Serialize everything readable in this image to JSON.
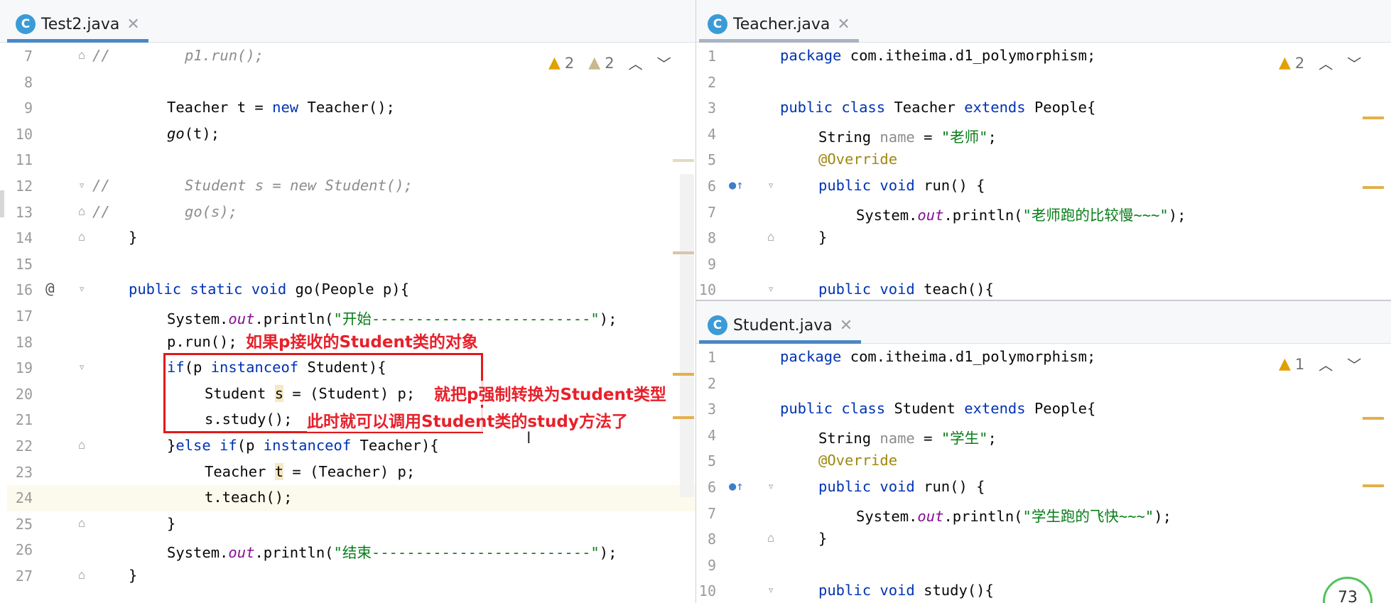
{
  "left_tab": {
    "title": "Test2.java",
    "icon": "C"
  },
  "teacher_tab": {
    "title": "Teacher.java",
    "icon": "C"
  },
  "student_tab": {
    "title": "Student.java",
    "icon": "C"
  },
  "left_inspection": {
    "warn1": "2",
    "warn2": "2"
  },
  "teacher_inspection": {
    "warn": "2"
  },
  "student_inspection": {
    "warn": "1"
  },
  "left_lines": [
    "7",
    "8",
    "9",
    "10",
    "11",
    "12",
    "13",
    "14",
    "15",
    "16",
    "17",
    "18",
    "19",
    "20",
    "21",
    "22",
    "23",
    "24",
    "25",
    "26",
    "27"
  ],
  "right_lines": [
    "1",
    "2",
    "3",
    "4",
    "5",
    "6",
    "7",
    "8",
    "9",
    "10"
  ],
  "code_left": {
    "l7_c": "//",
    "l7": "p1.run();",
    "l9_a": "Teacher t = ",
    "l9_kw": "new",
    "l9_b": " Teacher();",
    "l10_fn": "go",
    "l10": "(t);",
    "l12_c": "//",
    "l12": "Student s = new Student();",
    "l13_c": "//",
    "l13": "go(s);",
    "l14": "}",
    "l16_gutter": "@",
    "l16_kw": "public static void ",
    "l16": "go(People p){",
    "l17_a": "System.",
    "l17_f": "out",
    "l17_b": ".println(",
    "l17_s": "\"开始-------------------------\"",
    "l17_c": ");",
    "l18": "p.run();",
    "l19_kw": "if",
    "l19_a": "(p ",
    "l19_kw2": "instanceof",
    "l19_b": " Student){",
    "l20_a": "Student ",
    "l20_v": "s",
    "l20_b": " = (Student) p;",
    "l21": "s.study();",
    "l22_a": "}",
    "l22_kw": "else if",
    "l22_b": "(p ",
    "l22_kw2": "instanceof",
    "l22_c": " Teacher){",
    "l23_a": "Teacher ",
    "l23_v": "t",
    "l23_b": " = (Teacher) p;",
    "l24": "t.teach();",
    "l25": "}",
    "l26_a": "System.",
    "l26_f": "out",
    "l26_b": ".println(",
    "l26_s": "\"结束-------------------------\"",
    "l26_c": ");",
    "l27": "}"
  },
  "code_teacher": {
    "l1_kw": "package",
    "l1": " com.itheima.d1_polymorphism;",
    "l3_kw": "public class",
    "l3_a": " Teacher ",
    "l3_kw2": "extends",
    "l3_b": " People{",
    "l4_a": "String ",
    "l4_v": "name",
    "l4_b": " = ",
    "l4_s": "\"老师\"",
    "l4_c": ";",
    "l5": "@Override",
    "l6_kw": "public void",
    "l6": " run() {",
    "l7_a": "System.",
    "l7_f": "out",
    "l7_b": ".println(",
    "l7_s": "\"老师跑的比较慢~~~\"",
    "l7_c": ");",
    "l8": "}",
    "l10_kw": "public void",
    "l10": " teach(){"
  },
  "code_student": {
    "l1_kw": "package",
    "l1": " com.itheima.d1_polymorphism;",
    "l3_kw": "public class",
    "l3_a": " Student ",
    "l3_kw2": "extends",
    "l3_b": " People{",
    "l4_a": "String ",
    "l4_v": "name",
    "l4_b": " = ",
    "l4_s": "\"学生\"",
    "l4_c": ";",
    "l5": "@Override",
    "l6_kw": "public void",
    "l6": " run() {",
    "l7_a": "System.",
    "l7_f": "out",
    "l7_b": ".println(",
    "l7_s": "\"学生跑的飞快~~~\"",
    "l7_c": ");",
    "l8": "}",
    "l10_kw": "public void",
    "l10": " study(){"
  },
  "annotations": {
    "a1": "如果p接收的Student类的对象",
    "a2": "就把p强制转换为Student类型",
    "a3": "此时就可以调用Student类的study方法了"
  },
  "badge": "73",
  "colors": {
    "keyword": "#0033b3",
    "string": "#067d17",
    "annotation_red": "#e8202a",
    "tab_accent": "#4a88c7"
  }
}
